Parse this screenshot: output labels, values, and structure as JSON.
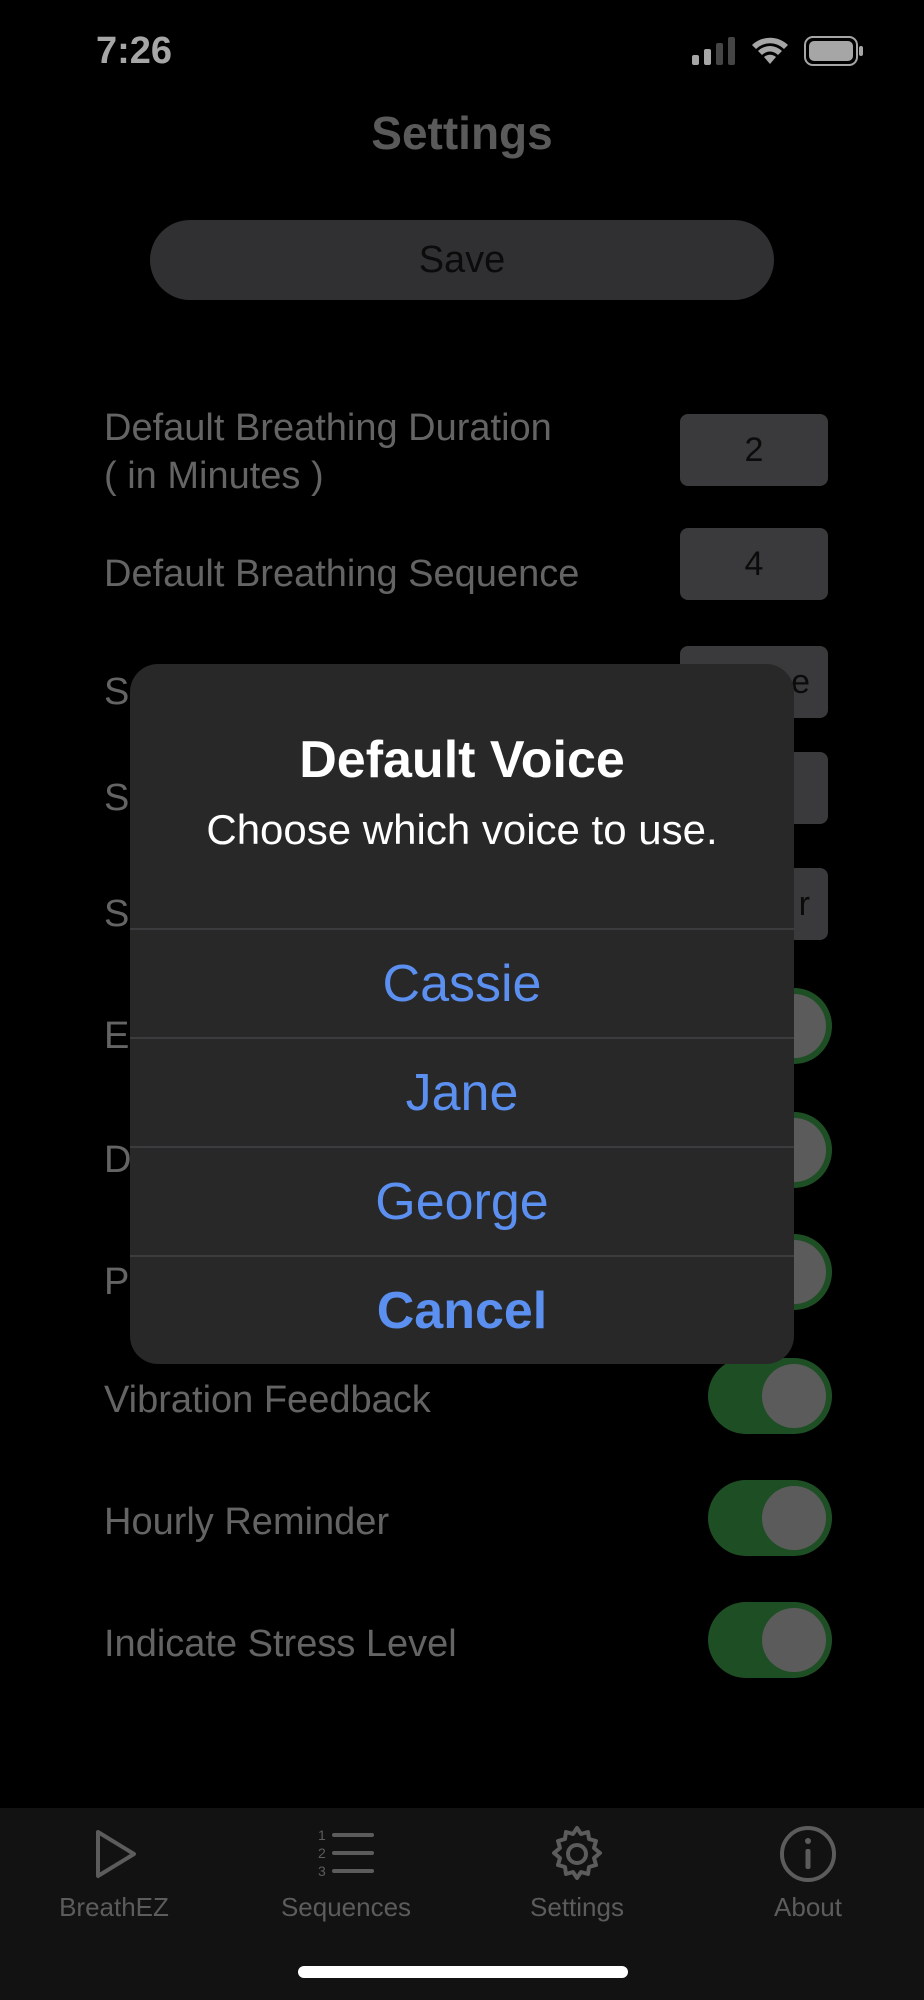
{
  "status_bar": {
    "time": "7:26"
  },
  "header": {
    "title": "Settings",
    "save_label": "Save"
  },
  "settings": {
    "duration_label_line1": "Default Breathing Duration",
    "duration_label_line2": "( in Minutes )",
    "duration_value": "2",
    "sequence_label": "Default Breathing Sequence",
    "sequence_value": "4",
    "partial_row_1_letter": "S",
    "partial_row_1_value": "e",
    "partial_row_2_letter": "S",
    "partial_row_3_letter": "S",
    "partial_row_3_value": "r",
    "partial_row_4_letter": "E",
    "partial_row_5_letter": "D",
    "partial_row_6_letter": "P",
    "vibration_label": "Vibration Feedback",
    "hourly_label": "Hourly Reminder",
    "stress_label": "Indicate Stress Level"
  },
  "alert": {
    "title": "Default Voice",
    "message": "Choose which voice to use.",
    "options": [
      "Cassie",
      "Jane",
      "George"
    ],
    "cancel_label": "Cancel",
    "accent_color": "#5b8ff0"
  },
  "tabs": [
    {
      "label": "BreathEZ",
      "icon": "play-icon"
    },
    {
      "label": "Sequences",
      "icon": "numbered-list-icon"
    },
    {
      "label": "Settings",
      "icon": "gear-icon"
    },
    {
      "label": "About",
      "icon": "info-icon"
    }
  ]
}
